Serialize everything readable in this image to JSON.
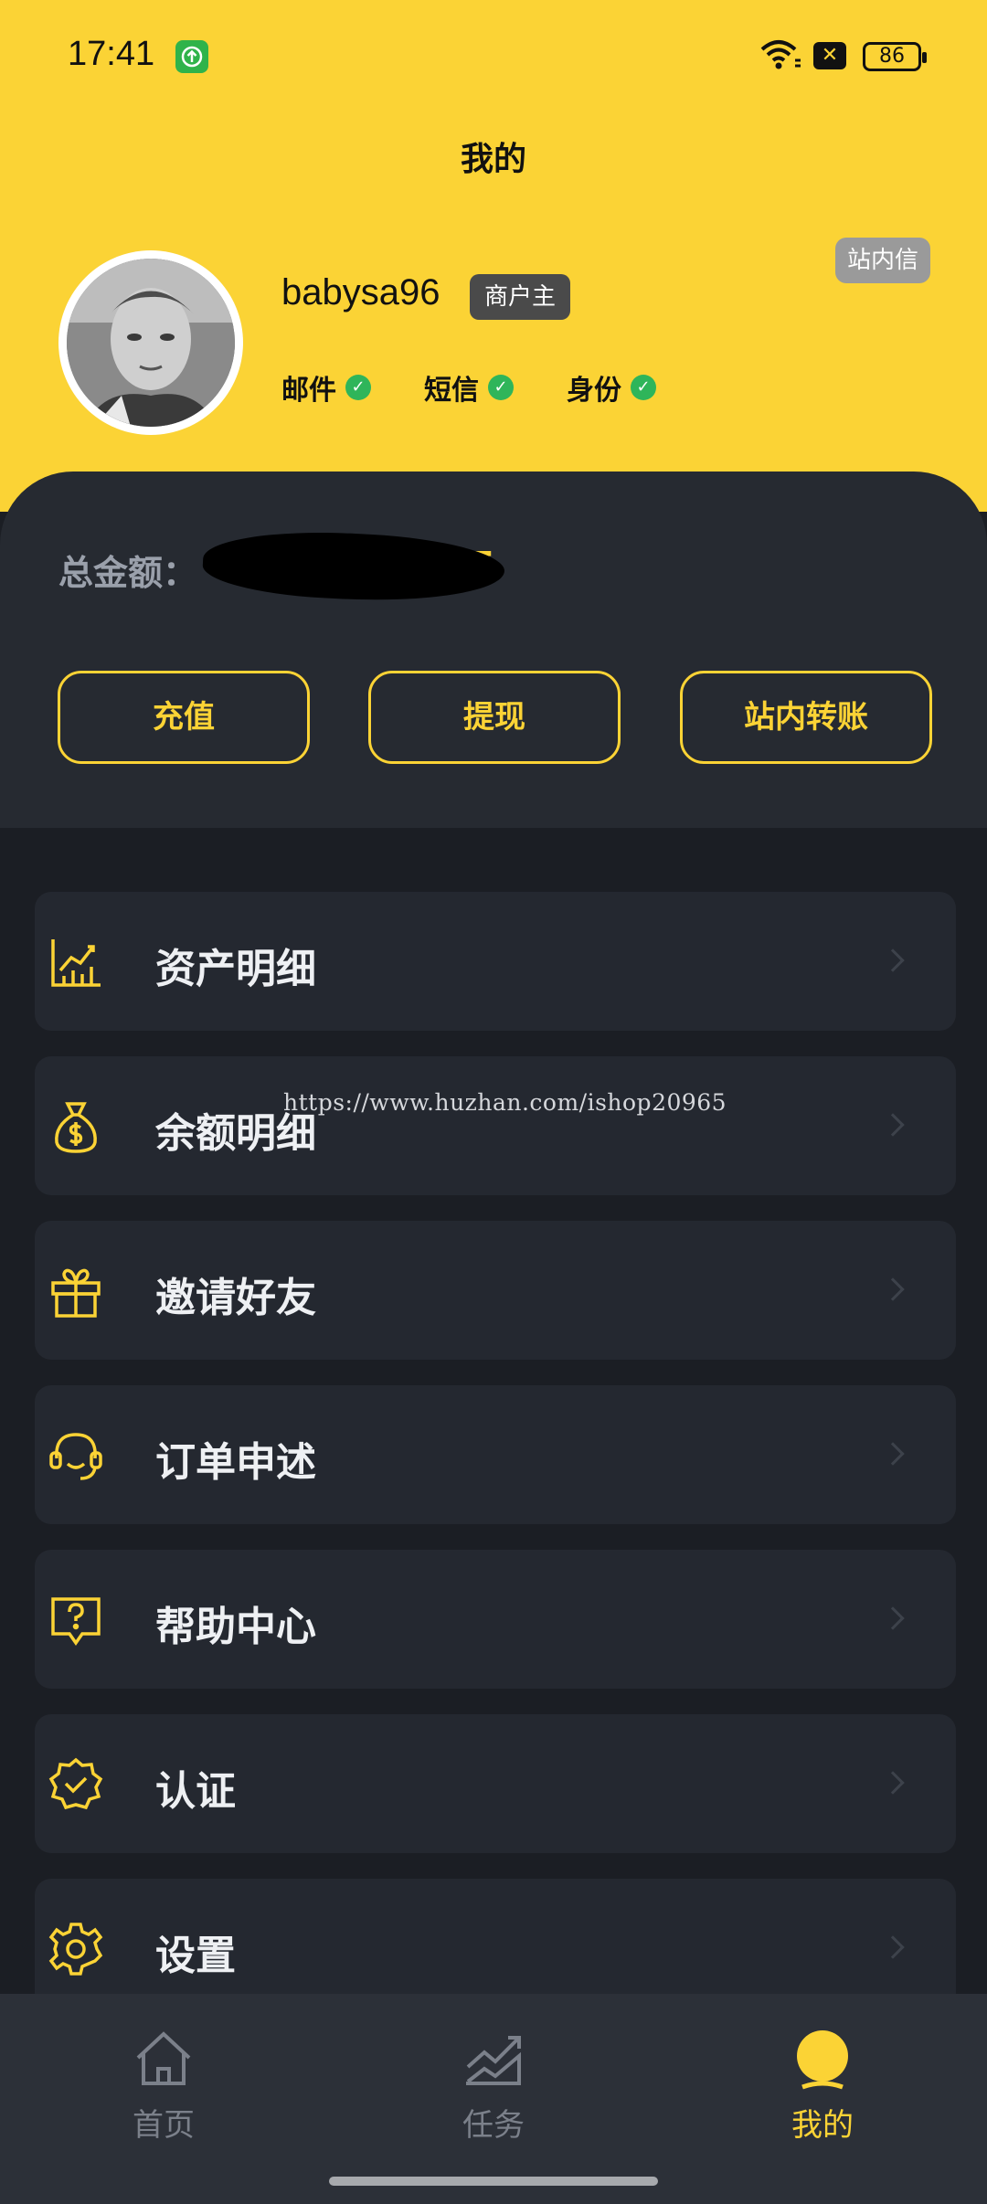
{
  "status_bar": {
    "time": "17:41",
    "battery": "86",
    "sim_icon": "x-icon"
  },
  "header": {
    "title": "我的"
  },
  "profile": {
    "username": "babysa96",
    "role_badge": "商户主",
    "inbox_badge": "站内信",
    "verifications": [
      {
        "label": "邮件",
        "verified": true
      },
      {
        "label": "短信",
        "verified": true
      },
      {
        "label": "身份",
        "verified": true
      }
    ]
  },
  "wallet": {
    "total_label": "总金额：",
    "total_value_visible": "DT",
    "buttons": {
      "recharge": "充值",
      "withdraw": "提现",
      "transfer": "站内转账"
    }
  },
  "menu": [
    {
      "label": "资产明细",
      "icon": "chart-icon"
    },
    {
      "label": "余额明细",
      "icon": "money-bag-icon"
    },
    {
      "label": "邀请好友",
      "icon": "gift-icon"
    },
    {
      "label": "订单申述",
      "icon": "headset-icon"
    },
    {
      "label": "帮助中心",
      "icon": "help-icon"
    },
    {
      "label": "认证",
      "icon": "verified-badge-icon"
    },
    {
      "label": "设置",
      "icon": "gear-icon"
    }
  ],
  "watermark": "https://www.huzhan.com/ishop20965",
  "tabbar": [
    {
      "label": "首页",
      "icon": "home-icon",
      "active": false
    },
    {
      "label": "任务",
      "icon": "trend-icon",
      "active": false
    },
    {
      "label": "我的",
      "icon": "profile-icon",
      "active": true
    }
  ],
  "colors": {
    "accent": "#fbd335",
    "background": "#1b1e24",
    "card": "#242830",
    "check": "#2fb55a"
  }
}
